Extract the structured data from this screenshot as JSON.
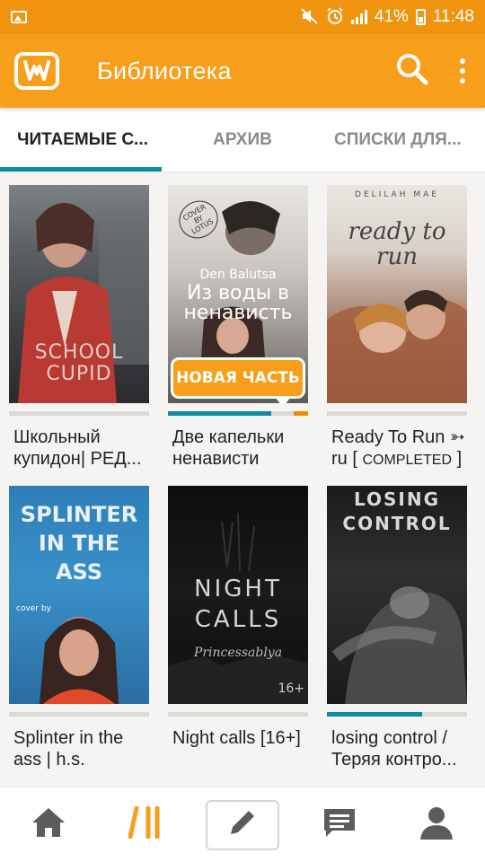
{
  "status_bar": {
    "battery": "41%",
    "time": "11:48"
  },
  "header": {
    "title": "Библиотека",
    "icons": [
      "wattpad-logo-icon",
      "search-icon",
      "more-vert-icon"
    ]
  },
  "tabs": [
    {
      "label": "ЧИТАЕМЫЕ С...",
      "active": true
    },
    {
      "label": "АРХИВ",
      "active": false
    },
    {
      "label": "СПИСКИ ДЛЯ...",
      "active": false
    }
  ],
  "books": [
    {
      "title_line1": "Школьный",
      "title_line2": "купидон| РЕД...",
      "cover_text": "SCHOOL CUPID",
      "progress": 0
    },
    {
      "title_line1": "Две капельки",
      "title_line2": "ненависти",
      "cover_author": "Den Balutsa",
      "cover_title": "Из воды в ненависть",
      "cover_stamp": "COVER BY LOTUS",
      "badge": "НОВАЯ ЧАСТЬ",
      "progress": 0.74
    },
    {
      "title_line1": "Ready To Run ➳",
      "title_line2_a": "ru [ ",
      "title_line2_b": "COMPLETED",
      "title_line2_c": " ]",
      "cover_author": "DELILAH MAE",
      "cover_title": "ready to run",
      "progress": 0
    },
    {
      "title_line1": "Splinter in the",
      "title_line2": "ass | h.s.",
      "cover_title": "SPLINTER IN THE ASS",
      "cover_credit": "cover by",
      "progress": 0
    },
    {
      "title_line1": "Night calls [16+]",
      "title_line2": "",
      "cover_title": "NIGHT CALLS",
      "cover_author": "Princessablya",
      "cover_rating": "16+",
      "progress": 0
    },
    {
      "title_line1": "losing control /",
      "title_line2": "Теряя контро...",
      "cover_title": "LOSING CONTROL",
      "progress": 0.68
    }
  ],
  "bottom_nav": {
    "items": [
      "home-icon",
      "library-icon",
      "write-icon",
      "messages-icon",
      "profile-icon"
    ],
    "active": "library-icon"
  },
  "colors": {
    "brand": "#f79e1b",
    "status_bar": "#f0940f",
    "accent": "#0c8ea0",
    "new_part": "#f08c00"
  }
}
